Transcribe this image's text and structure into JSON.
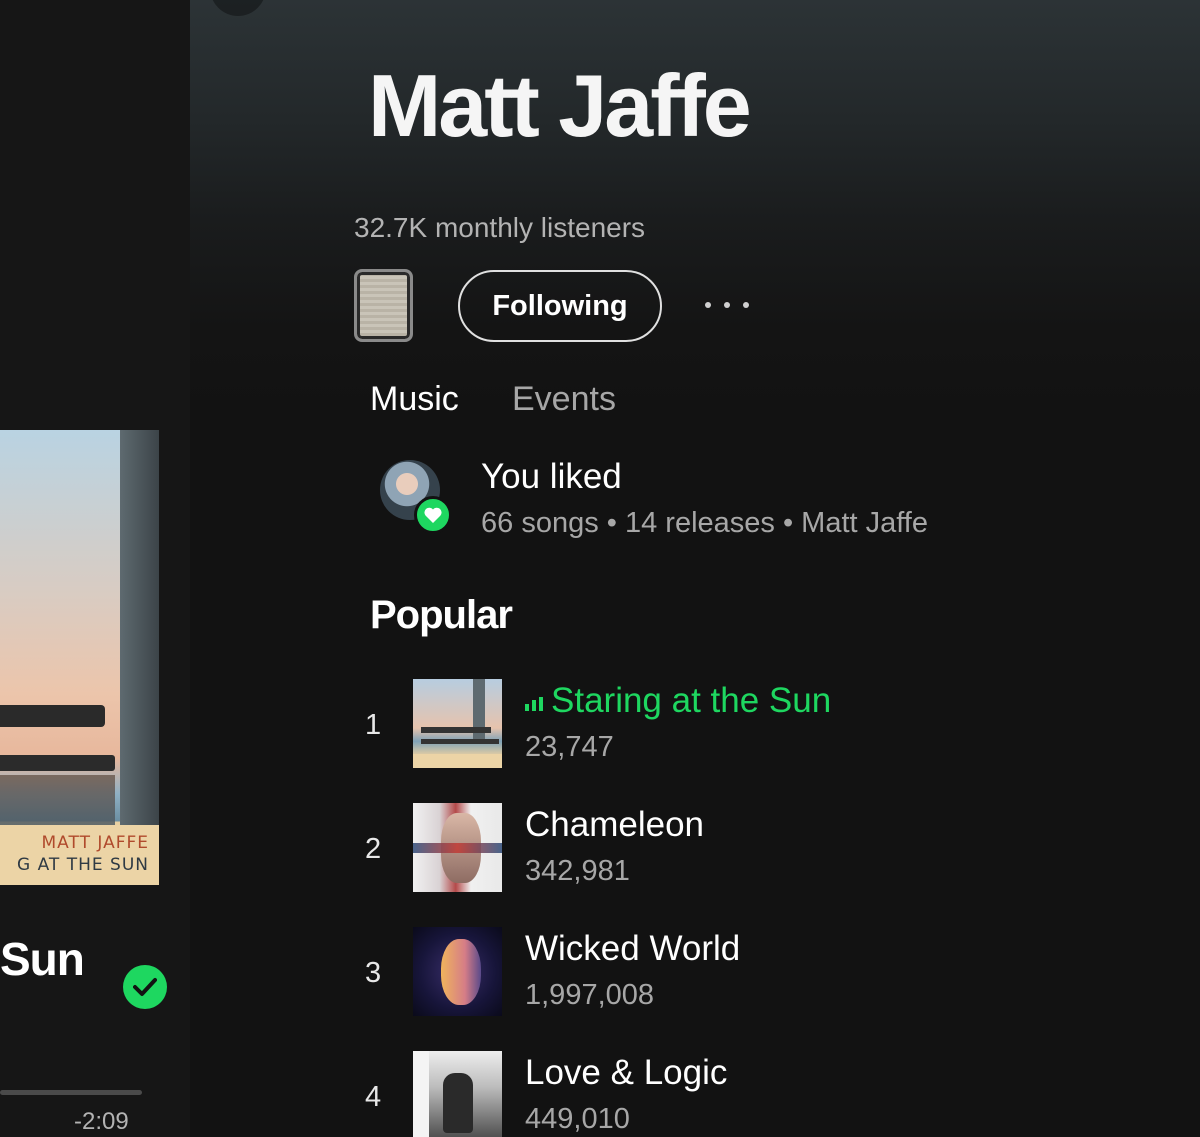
{
  "now_playing": {
    "title_partial": "Sun",
    "art_label_artist": "MATT JAFFE",
    "art_label_title": "G AT THE SUN",
    "remaining_time": "-2:09",
    "progress": 0.0
  },
  "artist": {
    "name": "Matt Jaffe",
    "monthly_listeners": "32.7K monthly listeners",
    "follow_label": "Following"
  },
  "tabs": [
    {
      "label": "Music",
      "active": true
    },
    {
      "label": "Events",
      "active": false
    }
  ],
  "liked": {
    "title": "You liked",
    "subtitle": "66 songs • 14 releases • Matt Jaffe"
  },
  "popular": {
    "heading": "Popular",
    "tracks": [
      {
        "rank": "1",
        "title": "Staring at the Sun",
        "plays": "23,747",
        "playing": true
      },
      {
        "rank": "2",
        "title": "Chameleon",
        "plays": "342,981",
        "playing": false
      },
      {
        "rank": "3",
        "title": "Wicked World",
        "plays": "1,997,008",
        "playing": false
      },
      {
        "rank": "4",
        "title": "Love & Logic",
        "plays": "449,010",
        "playing": false
      }
    ]
  },
  "colors": {
    "accent": "#1ed760",
    "background": "#121212",
    "secondary_text": "#a7a7a7"
  }
}
